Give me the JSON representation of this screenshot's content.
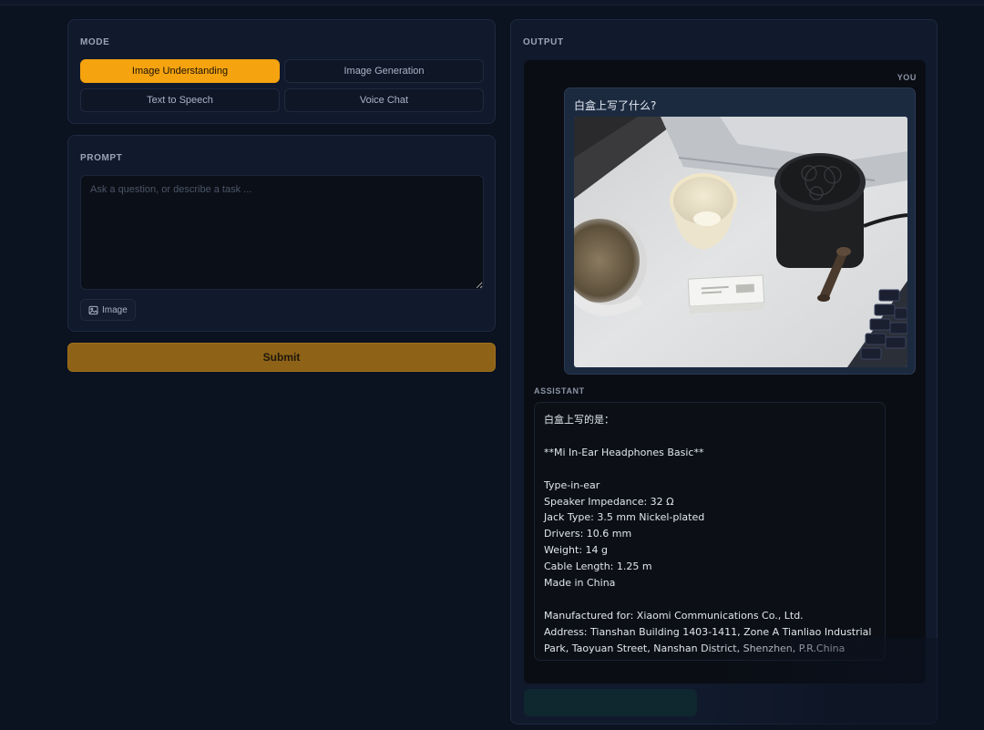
{
  "mode": {
    "label": "MODE",
    "options": [
      {
        "label": "Image Understanding",
        "active": true
      },
      {
        "label": "Image Generation",
        "active": false
      },
      {
        "label": "Text to Speech",
        "active": false
      },
      {
        "label": "Voice Chat",
        "active": false
      }
    ]
  },
  "prompt": {
    "label": "PROMPT",
    "value": "",
    "placeholder": "Ask a question, or describe a task ...",
    "image_button_label": "Image"
  },
  "submit_label": "Submit",
  "output": {
    "label": "OUTPUT",
    "you_label": "YOU",
    "user_message": "白盒上写了什么?",
    "assistant_label": "ASSISTANT",
    "assistant_message": "白盒上写的是：\n\n**Mi In-Ear Headphones Basic**\n\nType-in-ear\nSpeaker Impedance: 32 Ω\nJack Type: 3.5 mm Nickel-plated\nDrivers: 10.6 mm\nWeight: 14 g\nCable Length: 1.25 m\nMade in China\n\nManufactured for: Xiaomi Communications Co., Ltd.\nAddress: Tianshan Building 1403-1411, Zone A Tianliao Industrial Park, Taoyuan Street, Nanshan District, Shenzhen, P.R.China"
  },
  "colors": {
    "accent": "#f5a30f",
    "submit": "#8e6318",
    "background": "#0b1220"
  },
  "icons": {
    "image_button": "image-icon"
  }
}
